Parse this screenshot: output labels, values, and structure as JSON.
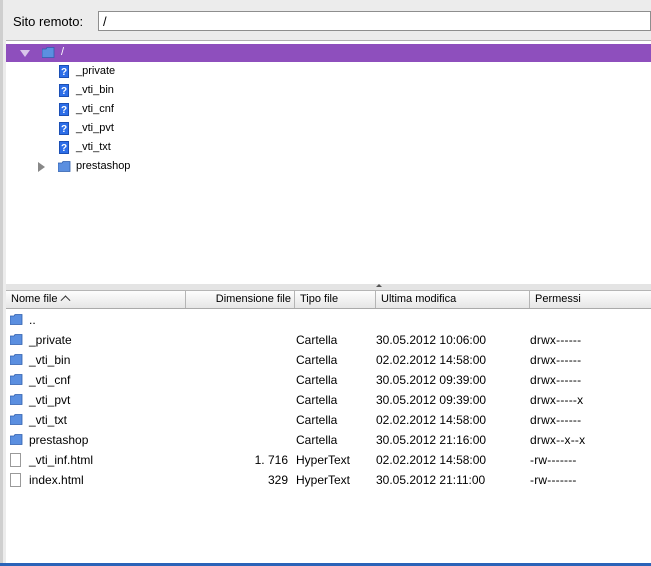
{
  "site": {
    "label": "Sito remoto:",
    "path": "/"
  },
  "tree": {
    "root": {
      "label": "/"
    },
    "children": [
      {
        "label": "_private",
        "icon": "unknown-icon"
      },
      {
        "label": "_vti_bin",
        "icon": "unknown-icon"
      },
      {
        "label": "_vti_cnf",
        "icon": "unknown-icon"
      },
      {
        "label": "_vti_pvt",
        "icon": "unknown-icon"
      },
      {
        "label": "_vti_txt",
        "icon": "unknown-icon"
      },
      {
        "label": "prestashop",
        "icon": "folder-icon"
      }
    ]
  },
  "columns": {
    "name": "Nome file",
    "size": "Dimensione file",
    "type": "Tipo file",
    "modified": "Ultima modifica",
    "perms": "Permessi"
  },
  "files": [
    {
      "name": "..",
      "size": "",
      "type": "",
      "modified": "",
      "perms": "",
      "icon": "folder-icon"
    },
    {
      "name": "_private",
      "size": "",
      "type": "Cartella",
      "modified": "30.05.2012 10:06:00",
      "perms": "drwx------",
      "icon": "folder-icon"
    },
    {
      "name": "_vti_bin",
      "size": "",
      "type": "Cartella",
      "modified": "02.02.2012 14:58:00",
      "perms": "drwx------",
      "icon": "folder-icon"
    },
    {
      "name": "_vti_cnf",
      "size": "",
      "type": "Cartella",
      "modified": "30.05.2012 09:39:00",
      "perms": "drwx------",
      "icon": "folder-icon"
    },
    {
      "name": "_vti_pvt",
      "size": "",
      "type": "Cartella",
      "modified": "30.05.2012 09:39:00",
      "perms": "drwx-----x",
      "icon": "folder-icon"
    },
    {
      "name": "_vti_txt",
      "size": "",
      "type": "Cartella",
      "modified": "02.02.2012 14:58:00",
      "perms": "drwx------",
      "icon": "folder-icon"
    },
    {
      "name": "prestashop",
      "size": "",
      "type": "Cartella",
      "modified": "30.05.2012 21:16:00",
      "perms": "drwx--x--x",
      "icon": "folder-icon"
    },
    {
      "name": "_vti_inf.html",
      "size": "1. 716",
      "type": "HyperText",
      "modified": "02.02.2012 14:58:00",
      "perms": "-rw-------",
      "icon": "file-icon"
    },
    {
      "name": "index.html",
      "size": "329",
      "type": "HyperText",
      "modified": "30.05.2012 21:11:00",
      "perms": "-rw-------",
      "icon": "file-icon"
    }
  ],
  "colors": {
    "selection": "#8e4fbd",
    "folder": "#4a86e8",
    "unknown": "#2d6ee8"
  }
}
